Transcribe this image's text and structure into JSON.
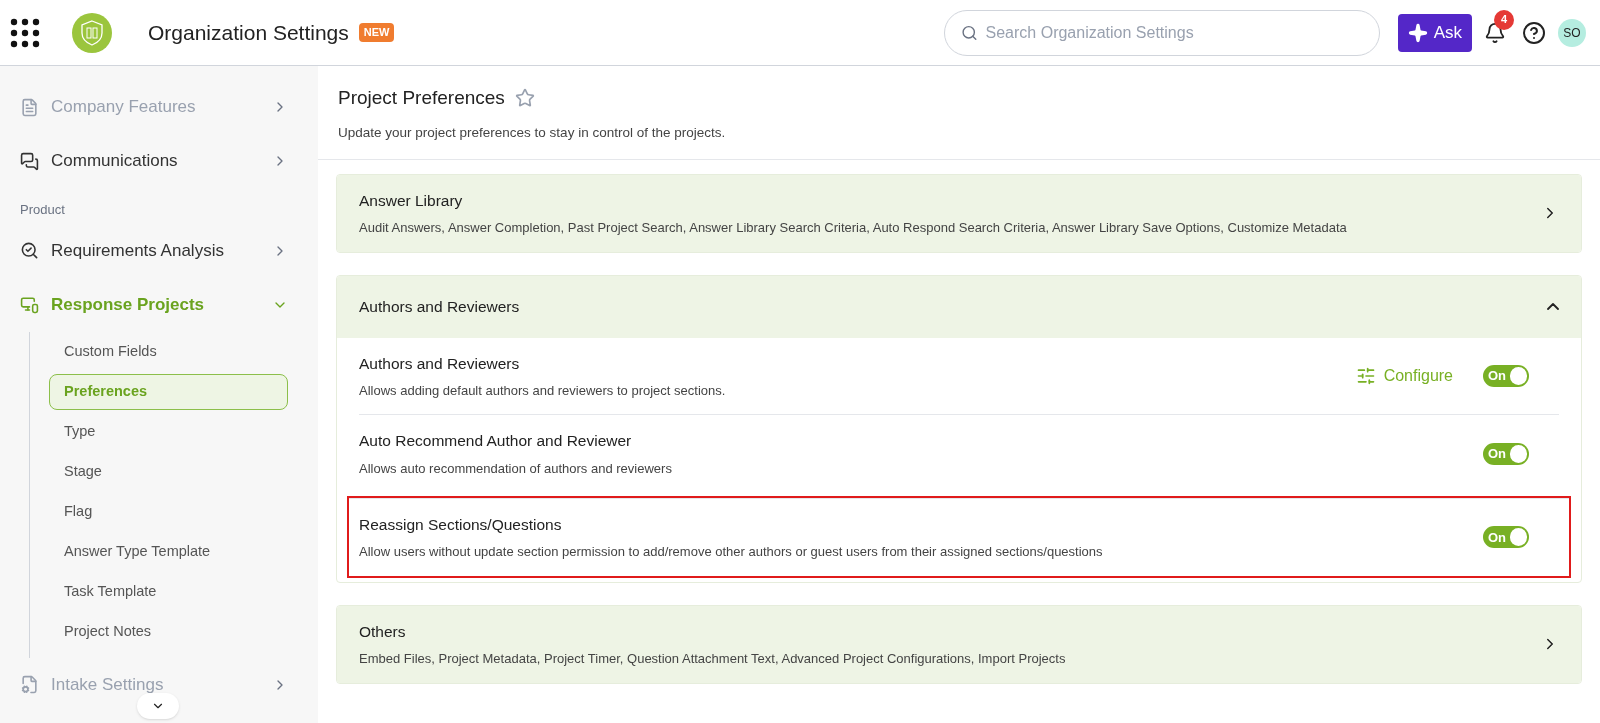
{
  "header": {
    "title": "Organization Settings",
    "badge": "NEW",
    "search": {
      "placeholder": "Search Organization Settings"
    },
    "ask_button": "Ask",
    "notifications": "4",
    "avatar": "SO"
  },
  "sidebar": {
    "items": [
      {
        "kind": "item",
        "label": "Company Features",
        "dimmed": true,
        "expanded": false
      },
      {
        "kind": "item",
        "label": "Communications",
        "dimmed": false,
        "expanded": false
      },
      {
        "kind": "group",
        "label": "Product"
      },
      {
        "kind": "item",
        "label": "Requirements Analysis",
        "dimmed": false,
        "expanded": false
      },
      {
        "kind": "item",
        "label": "Response Projects",
        "dimmed": false,
        "expanded": true,
        "children": [
          {
            "label": "Custom Fields",
            "selected": false
          },
          {
            "label": "Preferences",
            "selected": true
          },
          {
            "label": "Type",
            "selected": false
          },
          {
            "label": "Stage",
            "selected": false
          },
          {
            "label": "Flag",
            "selected": false
          },
          {
            "label": "Answer Type Template",
            "selected": false
          },
          {
            "label": "Task Template",
            "selected": false
          },
          {
            "label": "Project Notes",
            "selected": false
          }
        ]
      },
      {
        "kind": "item",
        "label": "Intake Settings",
        "dimmed": true,
        "expanded": false
      }
    ]
  },
  "page": {
    "title": "Project Preferences",
    "subtitle": "Update your project preferences to stay in control of the projects."
  },
  "sections": [
    {
      "title": "Answer Library",
      "summary": "Audit Answers, Answer Completion, Past Project Search, Answer Library Search Criteria, Auto Respond Search Criteria, Answer Library Save Options, Customize Metadata",
      "expanded": false
    },
    {
      "title": "Authors and Reviewers",
      "expanded": true,
      "settings": [
        {
          "title": "Authors and Reviewers",
          "description": "Allows adding default authors and reviewers to project sections.",
          "configure": "Configure",
          "toggle": "On",
          "on": true,
          "highlighted": false
        },
        {
          "title": "Auto Recommend Author and Reviewer",
          "description": "Allows auto recommendation of authors and reviewers",
          "toggle": "On",
          "on": true,
          "highlighted": false
        },
        {
          "title": "Reassign Sections/Questions",
          "description": "Allow users without update section permission to add/remove other authors or guest users from their assigned sections/questions",
          "toggle": "On",
          "on": true,
          "highlighted": true
        }
      ]
    },
    {
      "title": "Others",
      "summary": "Embed Files, Project Metadata, Project Timer, Question Attachment Text, Advanced Project Configurations, Import Projects",
      "expanded": false
    }
  ]
}
